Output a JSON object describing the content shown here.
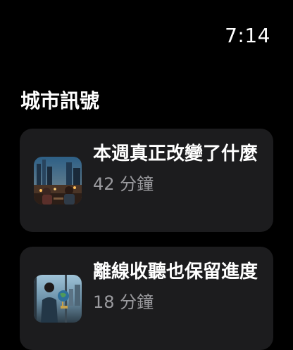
{
  "status": {
    "time": "7:14"
  },
  "section": {
    "title": "城市訊號"
  },
  "episodes": [
    {
      "title": "本週真正改變了什麼",
      "duration": "42 分鐘",
      "thumbnail_icon": "city-night-cafe-thumbnail"
    },
    {
      "title": "離線收聽也保留進度",
      "duration": "18 分鐘",
      "thumbnail_icon": "globe-window-thumbnail"
    }
  ],
  "colors": {
    "background": "#000000",
    "card": "#1c1c1e",
    "secondary_text": "#9b9b9f"
  }
}
